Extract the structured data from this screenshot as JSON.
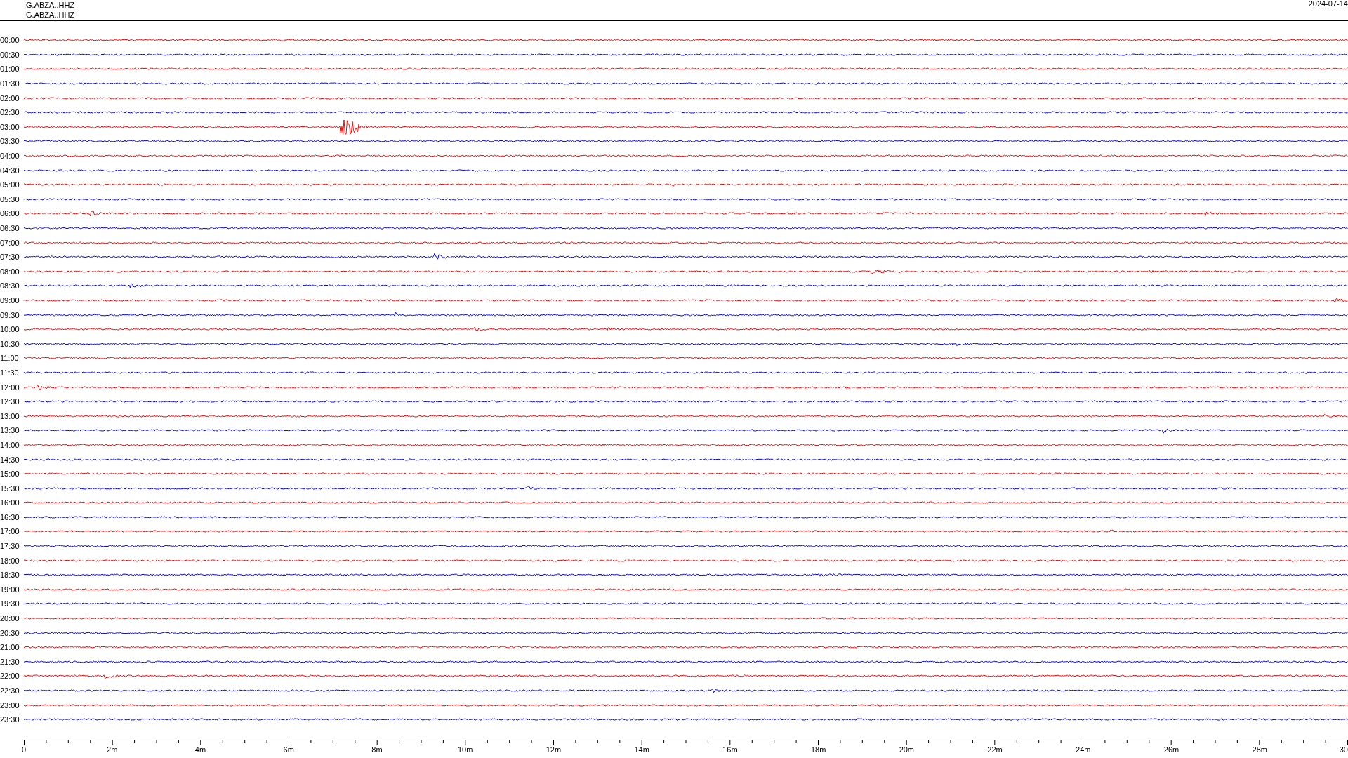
{
  "header": {
    "stations": [
      "IG.ABZA..HHZ",
      "IG.ABZA..HHZ"
    ],
    "date": "2024-07-14"
  },
  "rows": [
    {
      "label": "00:00",
      "color": "#ff0000"
    },
    {
      "label": "00:30",
      "color": "#0000ff"
    },
    {
      "label": "01:00",
      "color": "#ff0000"
    },
    {
      "label": "01:30",
      "color": "#0000ff"
    },
    {
      "label": "02:00",
      "color": "#ff0000"
    },
    {
      "label": "02:30",
      "color": "#0000ff"
    },
    {
      "label": "03:00",
      "color": "#ff0000"
    },
    {
      "label": "03:30",
      "color": "#0000ff"
    },
    {
      "label": "04:00",
      "color": "#ff0000"
    },
    {
      "label": "04:30",
      "color": "#0000ff"
    },
    {
      "label": "05:00",
      "color": "#ff0000"
    },
    {
      "label": "05:30",
      "color": "#0000ff"
    },
    {
      "label": "06:00",
      "color": "#ff0000"
    },
    {
      "label": "06:30",
      "color": "#0000ff"
    },
    {
      "label": "07:00",
      "color": "#ff0000"
    },
    {
      "label": "07:30",
      "color": "#0000ff"
    },
    {
      "label": "08:00",
      "color": "#ff0000"
    },
    {
      "label": "08:30",
      "color": "#0000ff"
    },
    {
      "label": "09:00",
      "color": "#ff0000"
    },
    {
      "label": "09:30",
      "color": "#0000ff"
    },
    {
      "label": "10:00",
      "color": "#ff0000"
    },
    {
      "label": "10:30",
      "color": "#0000ff"
    },
    {
      "label": "11:00",
      "color": "#ff0000"
    },
    {
      "label": "11:30",
      "color": "#0000ff"
    },
    {
      "label": "12:00",
      "color": "#ff0000"
    },
    {
      "label": "12:30",
      "color": "#0000ff"
    },
    {
      "label": "13:00",
      "color": "#ff0000"
    },
    {
      "label": "13:30",
      "color": "#0000ff"
    },
    {
      "label": "14:00",
      "color": "#ff0000"
    },
    {
      "label": "14:30",
      "color": "#0000ff"
    },
    {
      "label": "15:00",
      "color": "#ff0000"
    },
    {
      "label": "15:30",
      "color": "#0000ff"
    },
    {
      "label": "16:00",
      "color": "#ff0000"
    },
    {
      "label": "16:30",
      "color": "#0000ff"
    },
    {
      "label": "17:00",
      "color": "#ff0000"
    },
    {
      "label": "17:30",
      "color": "#0000ff"
    },
    {
      "label": "18:00",
      "color": "#ff0000"
    },
    {
      "label": "18:30",
      "color": "#0000ff"
    },
    {
      "label": "19:00",
      "color": "#ff0000"
    },
    {
      "label": "19:30",
      "color": "#0000ff"
    },
    {
      "label": "20:00",
      "color": "#ff0000"
    },
    {
      "label": "20:30",
      "color": "#0000ff"
    },
    {
      "label": "21:00",
      "color": "#ff0000"
    },
    {
      "label": "21:30",
      "color": "#0000ff"
    },
    {
      "label": "22:00",
      "color": "#ff0000"
    },
    {
      "label": "22:30",
      "color": "#0000ff"
    },
    {
      "label": "23:00",
      "color": "#ff0000"
    },
    {
      "label": "23:30",
      "color": "#0000ff"
    }
  ],
  "x_axis": {
    "ticks": [
      "0",
      "2m",
      "4m",
      "6m",
      "8m",
      "10m",
      "12m",
      "14m",
      "16m",
      "18m",
      "20m",
      "22m",
      "24m",
      "26m",
      "28m",
      "30"
    ]
  }
}
